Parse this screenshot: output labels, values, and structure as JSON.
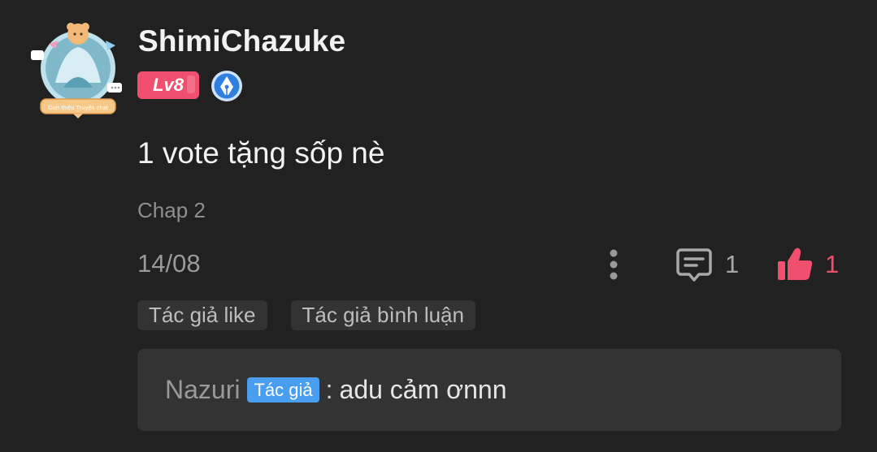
{
  "comment": {
    "username": "ShimiChazuke",
    "level": "Lv8",
    "text": "1 vote tặng sốp nè",
    "chapter": "Chap 2",
    "date": "14/08",
    "reply_count": "1",
    "like_count": "1",
    "avatar_caption": "Giới thiệu Truyện chat"
  },
  "tags": [
    "Tác giả like",
    "Tác giả bình luận"
  ],
  "reply": {
    "user": "Nazuri",
    "badge": "Tác giả",
    "separator": ":",
    "text": "adu cảm ơnnn"
  },
  "colors": {
    "background": "#212121",
    "accent_pink": "#f0506e",
    "author_badge_blue": "#4a9ef0",
    "tag_bg": "#333333"
  },
  "icons": {
    "avatar": "avatar-frame-icon",
    "writer_badge": "pen-nib-badge-icon",
    "more": "more-vertical-icon",
    "reply": "comment-bubble-icon",
    "like": "thumbs-up-icon"
  }
}
